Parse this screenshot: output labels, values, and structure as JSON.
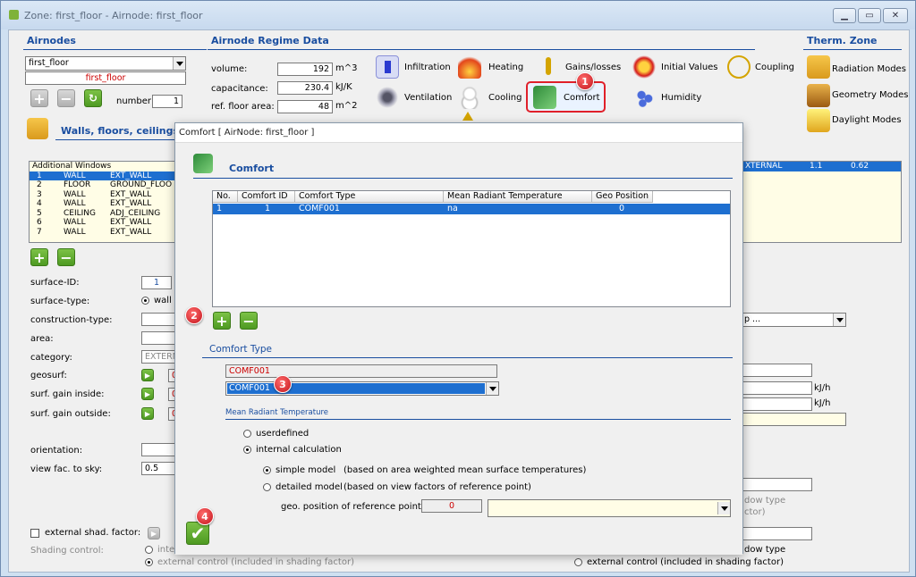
{
  "window": {
    "title": "Zone: first_floor  -  Airnode: first_floor"
  },
  "airnodes": {
    "header": "Airnodes",
    "selected": "first_floor",
    "current": "first_floor",
    "number_label": "number:",
    "number": "1"
  },
  "regime": {
    "header": "Airnode Regime Data",
    "volume_label": "volume:",
    "volume": "192",
    "volume_unit": "m^3",
    "capacitance_label": "capacitance:",
    "capacitance": "230.4",
    "capacitance_unit": "kJ/K",
    "floor_label": "ref. floor area:",
    "floor": "48",
    "floor_unit": "m^2",
    "tools": {
      "infiltration": "Infiltration",
      "heating": "Heating",
      "gains": "Gains/losses",
      "initial": "Initial Values",
      "coupling": "Coupling",
      "ventilation": "Ventilation",
      "cooling": "Cooling",
      "comfort": "Comfort",
      "humidity": "Humidity"
    }
  },
  "therm": {
    "header": "Therm. Zone",
    "radiation": "Radiation Modes",
    "geometry": "Geometry Modes",
    "daylight": "Daylight Modes"
  },
  "walls": {
    "header": "Walls, floors, ceilings, r",
    "list_header": "Additional Windows",
    "rows": [
      {
        "no": "1",
        "type": "WALL",
        "cat": "EXT_WALL"
      },
      {
        "no": "2",
        "type": "FLOOR",
        "cat": "GROUND_FLOO"
      },
      {
        "no": "3",
        "type": "WALL",
        "cat": "EXT_WALL"
      },
      {
        "no": "4",
        "type": "WALL",
        "cat": "EXT_WALL"
      },
      {
        "no": "5",
        "type": "CEILING",
        "cat": "ADJ_CEILING"
      },
      {
        "no": "6",
        "type": "WALL",
        "cat": "EXT_WALL"
      },
      {
        "no": "7",
        "type": "WALL",
        "cat": "EXT_WALL"
      }
    ],
    "right_row": {
      "a": "XTERNAL",
      "b": "1.1",
      "c": "0.62"
    }
  },
  "surface": {
    "id_label": "surface-ID:",
    "id": "1",
    "type_label": "surface-type:",
    "type_value": "wall",
    "construction_label": "construction-type:",
    "area_label": "area:",
    "category_label": "category:",
    "category": "EXTERN",
    "geosurf_label": "geosurf:",
    "geosurf": "0",
    "gain_in_label": "surf. gain inside:",
    "gain_in": "0",
    "gain_out_label": "surf. gain outside:",
    "gain_out": "0",
    "orientation_label": "orientation:",
    "viewfac_label": "view fac. to sky:",
    "viewfac": "0.5",
    "shad_label": "external shad. factor:",
    "shading_label": "Shading control:",
    "internal": "inter",
    "ext_control": "external control (included in shading factor)",
    "ext_control_right": "external control (included in shading factor)",
    "right_combo": "p ...",
    "unit1": "kJ/h",
    "unit2": "kJ/h",
    "window_type": "dow type",
    "actor": "ctor)",
    "window_type2": "dow type"
  },
  "dialog": {
    "title": "Comfort [ AirNode: first_floor ]",
    "header": "Comfort",
    "columns": [
      "No.",
      "Comfort ID",
      "Comfort Type",
      "Mean Radiant Temperature",
      "Geo Position"
    ],
    "rows": [
      {
        "no": "1",
        "id": "1",
        "type": "COMF001",
        "mrt": "na",
        "geo": "0"
      }
    ],
    "type_section": "Comfort Type",
    "type_name": "COMF001",
    "type_selected": "COMF001",
    "mrt_section": "Mean Radiant Temperature",
    "userdefined": "userdefined",
    "internal": "internal calculation",
    "simple": "simple model",
    "simple_desc": "(based on area weighted mean surface temperatures)",
    "detailed": "detailed model",
    "detailed_desc": "(based on view factors of reference point)",
    "geo_label": "geo. position of reference point:",
    "geo_value": "0"
  },
  "badges": [
    "1",
    "2",
    "3",
    "4"
  ]
}
